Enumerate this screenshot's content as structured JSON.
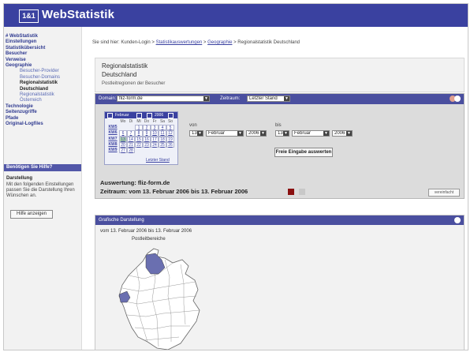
{
  "header": {
    "logo": "1&1",
    "title": "WebStatistik"
  },
  "sidebar": {
    "items": [
      {
        "label": "# WebStatistik",
        "kind": "h"
      },
      {
        "label": "Einstellungen",
        "kind": "h"
      },
      {
        "label": "Statistikübersicht",
        "kind": "h"
      },
      {
        "label": "Besucher",
        "kind": "h"
      },
      {
        "label": "Verweise",
        "kind": "h"
      },
      {
        "label": "Geographie",
        "kind": "h"
      },
      {
        "label": "Besucher-Provider",
        "kind": "sub"
      },
      {
        "label": "Besucher-Domains",
        "kind": "sub"
      },
      {
        "label": "Regionalstatistik",
        "kind": "cur"
      },
      {
        "label": "Deutschland",
        "kind": "cur"
      },
      {
        "label": "Regionalstatistik",
        "kind": "sub"
      },
      {
        "label": "Österreich",
        "kind": "sub"
      },
      {
        "label": "Technologie",
        "kind": "h"
      },
      {
        "label": "Seitenzugriffe",
        "kind": "h"
      },
      {
        "label": "Pfade",
        "kind": "h"
      },
      {
        "label": "Original-Logfiles",
        "kind": "h"
      }
    ],
    "help_bar": "Benötigen Sie Hilfe?",
    "help_title": "Darstellung",
    "help_text": "Mit den folgenden Einstellungen passen Sie die Darstellung Ihren Wünschen an.",
    "help_button": "Hilfe anzeigen"
  },
  "breadcrumb": {
    "prefix": "Sie sind hier: Kunden-Login >",
    "link1": "Statistikauswertungen",
    "link2": "Geographie",
    "current": "> Regionalstatistik Deutschland"
  },
  "page": {
    "title1": "Regionalstatistik",
    "title2": "Deutschland",
    "subtitle": "Postleitregionen der Besucher"
  },
  "filter": {
    "domain_label": "Domain:",
    "domain_value": "fliz-form.de",
    "zeitraum_label": "Zeitraum:",
    "zeitraum_value": "Letzter Stand",
    "cal_month": "Februar",
    "cal_year": "2006",
    "weekdays": [
      "Mo",
      "Di",
      "Mi",
      "Do",
      "Fr",
      "Sa",
      "So"
    ],
    "weeks": [
      {
        "kw": "KW5",
        "days": [
          "",
          "",
          "1",
          "2",
          "3",
          "4",
          "5"
        ]
      },
      {
        "kw": "KW6",
        "days": [
          "6",
          "7",
          "8",
          "9",
          "10",
          "11",
          "12"
        ]
      },
      {
        "kw": "KW7",
        "days": [
          "13",
          "14",
          "15",
          "16",
          "17",
          "18",
          "19"
        ]
      },
      {
        "kw": "KW8",
        "days": [
          "20",
          "21",
          "22",
          "23",
          "24",
          "25",
          "26"
        ]
      },
      {
        "kw": "KW9",
        "days": [
          "27",
          "28",
          "",
          "",
          "",
          "",
          ""
        ]
      }
    ],
    "today": "13",
    "letzter_stand_link": "Letzter Stand",
    "von_label": "von",
    "bis_label": "bis",
    "von_day": "13",
    "von_month": "Februar",
    "von_year": "2006",
    "bis_day": "13",
    "bis_month": "Februar",
    "bis_year": "2006",
    "apply_button": "Freie Eingabe auswerten",
    "auswertung": "Auswertung: fliz-form.de",
    "zeitraum_text": "Zeitraum:     vom 13. Februar 2006  bis 13. Februar 2006",
    "view_button": "vereinfacht"
  },
  "graph": {
    "header": "Grafische Darstellung",
    "range": "vom 13. Februar 2006  bis 13. Februar 2006",
    "map_label": "Postleitbereiche"
  },
  "colors": {
    "brand": "#3a41a0",
    "panel_head": "#4a4f9f",
    "highlight": "#6a6fb0"
  }
}
